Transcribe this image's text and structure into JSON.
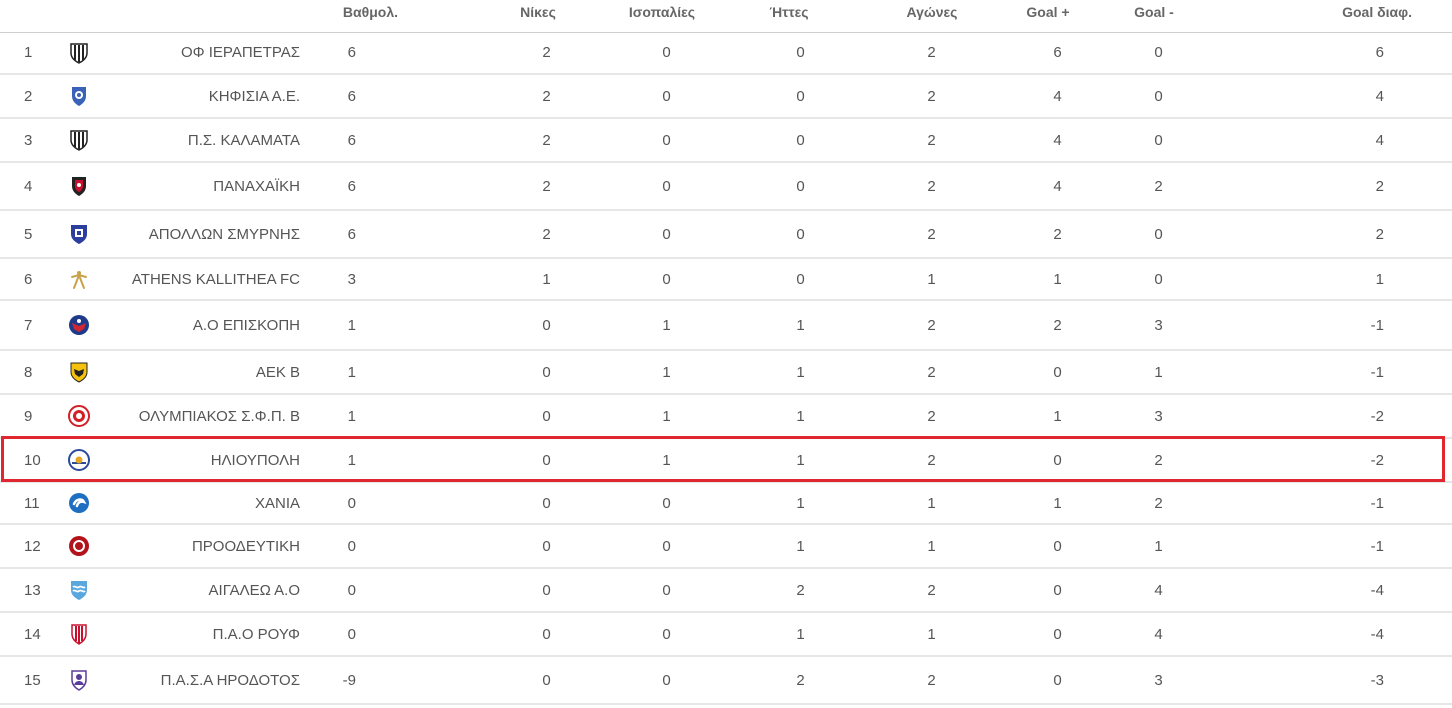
{
  "table": {
    "headers": {
      "points": "Βαθμολ.",
      "wins": "Νίκες",
      "draws": "Ισοπαλίες",
      "losses": "Ήττες",
      "played": "Αγώνες",
      "goals_for": "Goal +",
      "goals_against": "Goal -",
      "goal_diff": "Goal διαφ."
    },
    "highlighted_rank": "10",
    "highlight_color": "#e0262e",
    "rows": [
      {
        "rank": "1",
        "team": "ΟΦ ΙΕΡΑΠΕΤΡΑΣ",
        "logo": "black-white-striped-crest-icon",
        "points": "6",
        "wins": "2",
        "draws": "0",
        "losses": "0",
        "played": "2",
        "goals_for": "6",
        "goals_against": "0",
        "goal_diff": "6"
      },
      {
        "rank": "2",
        "team": "ΚΗΦΙΣΙΑ Α.Ε.",
        "logo": "blue-shield-crest-icon",
        "points": "6",
        "wins": "2",
        "draws": "0",
        "losses": "0",
        "played": "2",
        "goals_for": "4",
        "goals_against": "0",
        "goal_diff": "4"
      },
      {
        "rank": "3",
        "team": "Π.Σ. ΚΑΛΑΜΑΤΑ",
        "logo": "black-white-striped-crest-icon",
        "points": "6",
        "wins": "2",
        "draws": "0",
        "losses": "0",
        "played": "2",
        "goals_for": "4",
        "goals_against": "0",
        "goal_diff": "4"
      },
      {
        "rank": "4",
        "team": "ΠΑΝΑΧΑΪΚΗ",
        "logo": "red-black-shield-crest-icon",
        "points": "6",
        "wins": "2",
        "draws": "0",
        "losses": "0",
        "played": "2",
        "goals_for": "4",
        "goals_against": "2",
        "goal_diff": "2"
      },
      {
        "rank": "5",
        "team": "ΑΠΟΛΛΩΝ ΣΜΥΡΝΗΣ",
        "logo": "blue-white-shield-crest-icon",
        "points": "6",
        "wins": "2",
        "draws": "0",
        "losses": "0",
        "played": "2",
        "goals_for": "2",
        "goals_against": "0",
        "goal_diff": "2"
      },
      {
        "rank": "6",
        "team": "ATHENS KALLITHEA FC",
        "logo": "gold-figure-crest-icon",
        "points": "3",
        "wins": "1",
        "draws": "0",
        "losses": "0",
        "played": "1",
        "goals_for": "1",
        "goals_against": "0",
        "goal_diff": "1"
      },
      {
        "rank": "7",
        "team": "Α.Ο ΕΠΙΣΚΟΠΗ",
        "logo": "red-blue-eagle-crest-icon",
        "points": "1",
        "wins": "0",
        "draws": "1",
        "losses": "1",
        "played": "2",
        "goals_for": "2",
        "goals_against": "3",
        "goal_diff": "-1"
      },
      {
        "rank": "8",
        "team": "ΑΕΚ Β",
        "logo": "yellow-eagle-crest-icon",
        "points": "1",
        "wins": "0",
        "draws": "1",
        "losses": "1",
        "played": "2",
        "goals_for": "0",
        "goals_against": "1",
        "goal_diff": "-1"
      },
      {
        "rank": "9",
        "team": "ΟΛΥΜΠΙΑΚΟΣ Σ.Φ.Π. Β",
        "logo": "red-circle-crest-icon",
        "points": "1",
        "wins": "0",
        "draws": "1",
        "losses": "1",
        "played": "2",
        "goals_for": "1",
        "goals_against": "3",
        "goal_diff": "-2"
      },
      {
        "rank": "10",
        "team": "ΗΛΙΟΥΠΟΛΗ",
        "logo": "sun-circle-crest-icon",
        "points": "1",
        "wins": "0",
        "draws": "1",
        "losses": "1",
        "played": "2",
        "goals_for": "0",
        "goals_against": "2",
        "goal_diff": "-2"
      },
      {
        "rank": "11",
        "team": "ΧΑΝΙΑ",
        "logo": "blue-swirl-crest-icon",
        "points": "0",
        "wins": "0",
        "draws": "0",
        "losses": "1",
        "played": "1",
        "goals_for": "1",
        "goals_against": "2",
        "goal_diff": "-1"
      },
      {
        "rank": "12",
        "team": "ΠΡΟΟΔΕΥΤΙΚΗ",
        "logo": "red-round-crest-icon",
        "points": "0",
        "wins": "0",
        "draws": "0",
        "losses": "1",
        "played": "1",
        "goals_for": "0",
        "goals_against": "1",
        "goal_diff": "-1"
      },
      {
        "rank": "13",
        "team": "ΑΙΓΑΛΕΩ Α.Ο",
        "logo": "light-blue-wave-crest-icon",
        "points": "0",
        "wins": "0",
        "draws": "0",
        "losses": "2",
        "played": "2",
        "goals_for": "0",
        "goals_against": "4",
        "goal_diff": "-4"
      },
      {
        "rank": "14",
        "team": "Π.Α.Ο ΡΟΥΦ",
        "logo": "red-white-striped-crest-icon",
        "points": "0",
        "wins": "0",
        "draws": "0",
        "losses": "1",
        "played": "1",
        "goals_for": "0",
        "goals_against": "4",
        "goal_diff": "-4"
      },
      {
        "rank": "15",
        "team": "Π.Α.Σ.Α ΗΡΟΔΟΤΟΣ",
        "logo": "purple-bust-crest-icon",
        "points": "-9",
        "wins": "0",
        "draws": "0",
        "losses": "2",
        "played": "2",
        "goals_for": "0",
        "goals_against": "3",
        "goal_diff": "-3"
      }
    ]
  }
}
